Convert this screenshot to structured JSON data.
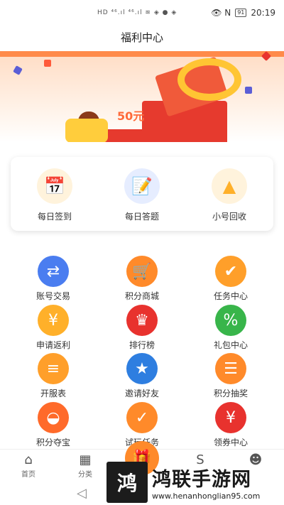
{
  "status_bar": {
    "left_icons": "HD ⁴⁶.ıl ⁴⁶.ıl ≋ ◈ ● ◈",
    "right_icons": "👁 N",
    "battery": "91",
    "time": "20:19"
  },
  "header": {
    "title": "福利中心"
  },
  "banner": {
    "tag": "50元"
  },
  "quick_actions": [
    {
      "label": "每日签到",
      "icon": "calendar-check-icon",
      "symbol": "📅"
    },
    {
      "label": "每日答题",
      "icon": "quiz-card-icon",
      "symbol": "📝"
    },
    {
      "label": "小号回收",
      "icon": "recycle-triangle-icon",
      "symbol": "▲"
    }
  ],
  "grid": [
    {
      "label": "账号交易",
      "icon": "account-trade-icon",
      "symbol": "⇄",
      "color": "#4a7df0"
    },
    {
      "label": "积分商城",
      "icon": "shopping-cart-icon",
      "symbol": "🛒",
      "color": "#ff8a2a"
    },
    {
      "label": "任务中心",
      "icon": "task-check-icon",
      "symbol": "✔",
      "color": "#ff9f2a"
    },
    {
      "label": "申请返利",
      "icon": "yen-coin-icon",
      "symbol": "¥",
      "color": "#ffb02a"
    },
    {
      "label": "排行榜",
      "icon": "crown-icon",
      "symbol": "♛",
      "color": "#e8322e"
    },
    {
      "label": "礼包中心",
      "icon": "gift-percent-icon",
      "symbol": "%",
      "color": "#38b54a"
    },
    {
      "label": "开服表",
      "icon": "server-list-icon",
      "symbol": "≡",
      "color": "#ff9f2a"
    },
    {
      "label": "邀请好友",
      "icon": "invite-friend-icon",
      "symbol": "★",
      "color": "#2e7ee0"
    },
    {
      "label": "积分抽奖",
      "icon": "coin-stack-icon",
      "symbol": "☰",
      "color": "#ff8a2a"
    },
    {
      "label": "积分夺宝",
      "icon": "gold-ingot-icon",
      "symbol": "◒",
      "color": "#ff6a2a"
    },
    {
      "label": "试玩任务",
      "icon": "clipboard-check-icon",
      "symbol": "✓",
      "color": "#ff8a2a"
    },
    {
      "label": "领券中心",
      "icon": "coupon-icon",
      "symbol": "¥",
      "color": "#e8322e"
    }
  ],
  "tabbar": {
    "home": "首页",
    "category": "分类",
    "center_icon": "gift-icon"
  },
  "watermark": {
    "brand_logo": "鸿",
    "title": "鸿联手游网",
    "url": "www.henanhonglian95.com"
  },
  "navbar": {
    "back_icon": "back-triangle-icon"
  }
}
